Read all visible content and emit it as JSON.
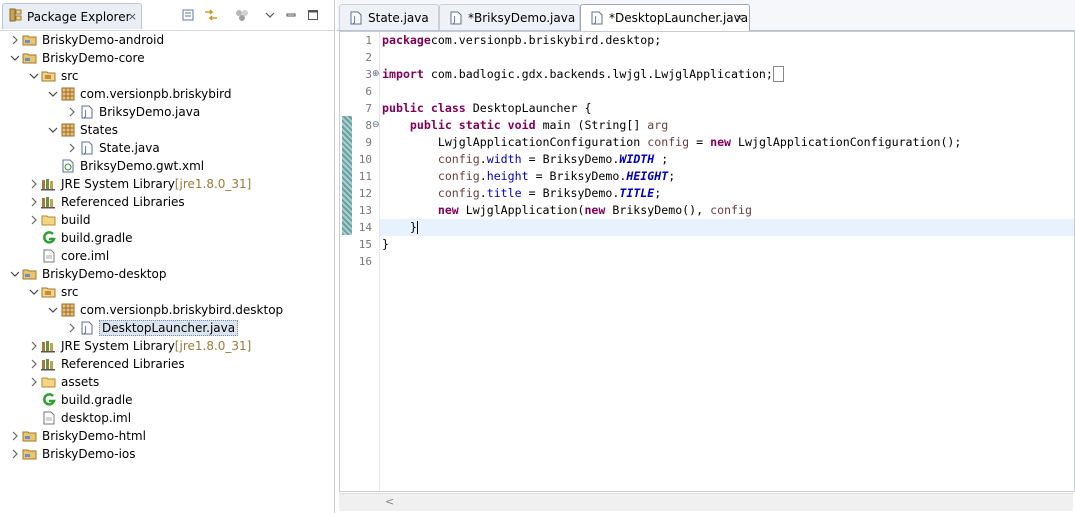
{
  "explorer": {
    "title": "Package Explorer",
    "close": "×",
    "toolbar": [
      "collapse-all-icon",
      "link-with-editor-icon",
      "focus-icon",
      "view-menu-icon",
      "minimize-icon",
      "maximize-icon"
    ],
    "tree": [
      {
        "depth": 0,
        "arrow": "right",
        "icon": "project-icon",
        "label": "BriskyDemo-android"
      },
      {
        "depth": 0,
        "arrow": "down",
        "icon": "project-icon",
        "label": "BriskyDemo-core"
      },
      {
        "depth": 1,
        "arrow": "down",
        "icon": "source-folder-icon",
        "label": "src"
      },
      {
        "depth": 2,
        "arrow": "down",
        "icon": "package-icon",
        "label": "com.versionpb.briskybird"
      },
      {
        "depth": 3,
        "arrow": "right",
        "icon": "java-file-icon",
        "label": "BriksyDemo.java"
      },
      {
        "depth": 2,
        "arrow": "down",
        "icon": "package-icon",
        "label": "States"
      },
      {
        "depth": 3,
        "arrow": "right",
        "icon": "java-file-icon",
        "label": "State.java"
      },
      {
        "depth": 2,
        "arrow": "",
        "icon": "gwt-xml-icon",
        "label": "BriksyDemo.gwt.xml"
      },
      {
        "depth": 1,
        "arrow": "right",
        "icon": "library-icon",
        "label": "JRE System Library",
        "suffix": "[jre1.8.0_31]"
      },
      {
        "depth": 1,
        "arrow": "right",
        "icon": "library-icon",
        "label": "Referenced Libraries"
      },
      {
        "depth": 1,
        "arrow": "right",
        "icon": "folder-icon",
        "label": "build"
      },
      {
        "depth": 1,
        "arrow": "",
        "icon": "gradle-icon",
        "label": "build.gradle"
      },
      {
        "depth": 1,
        "arrow": "",
        "icon": "file-icon",
        "label": "core.iml"
      },
      {
        "depth": 0,
        "arrow": "down",
        "icon": "project-icon",
        "label": "BriskyDemo-desktop"
      },
      {
        "depth": 1,
        "arrow": "down",
        "icon": "source-folder-icon",
        "label": "src"
      },
      {
        "depth": 2,
        "arrow": "down",
        "icon": "package-icon",
        "label": "com.versionpb.briskybird.desktop"
      },
      {
        "depth": 3,
        "arrow": "right",
        "icon": "java-file-icon",
        "label": "DesktopLauncher.java",
        "selected": true
      },
      {
        "depth": 1,
        "arrow": "right",
        "icon": "library-icon",
        "label": "JRE System Library",
        "suffix": "[jre1.8.0_31]"
      },
      {
        "depth": 1,
        "arrow": "right",
        "icon": "library-icon",
        "label": "Referenced Libraries"
      },
      {
        "depth": 1,
        "arrow": "right",
        "icon": "folder-icon",
        "label": "assets"
      },
      {
        "depth": 1,
        "arrow": "",
        "icon": "gradle-icon",
        "label": "build.gradle"
      },
      {
        "depth": 1,
        "arrow": "",
        "icon": "file-icon",
        "label": "desktop.iml"
      },
      {
        "depth": 0,
        "arrow": "right",
        "icon": "project-icon",
        "label": "BriskyDemo-html"
      },
      {
        "depth": 0,
        "arrow": "right",
        "icon": "project-icon",
        "label": "BriskyDemo-ios"
      }
    ]
  },
  "editor": {
    "tabs": [
      {
        "label": "State.java",
        "active": false
      },
      {
        "label": "*BriksyDemo.java",
        "active": false
      },
      {
        "label": "*DesktopLauncher.java",
        "active": true,
        "close": "×"
      }
    ],
    "hscroll_left": "<",
    "current_line": 14,
    "line_numbers": [
      "1",
      "2",
      "3",
      "6",
      "7",
      "8",
      "9",
      "10",
      "11",
      "12",
      "13",
      "14",
      "15",
      "16"
    ],
    "lines": [
      {
        "n": "1",
        "segs": [
          [
            "kw",
            "package"
          ],
          [
            "",
            "com.versionpb.briskybird.desktop;"
          ]
        ]
      },
      {
        "n": "2",
        "segs": []
      },
      {
        "n": "3",
        "fold": "⊕",
        "segs": [
          [
            "kw",
            "import"
          ],
          [
            "",
            " com.badlogic.gdx.backends.lwjgl.LwjglApplication;"
          ],
          [
            "box",
            "_"
          ]
        ]
      },
      {
        "n": "6",
        "segs": []
      },
      {
        "n": "7",
        "segs": [
          [
            "kw",
            "public"
          ],
          [
            "",
            " "
          ],
          [
            "kw",
            "class"
          ],
          [
            "",
            " DesktopLauncher {"
          ]
        ]
      },
      {
        "n": "8",
        "fold": "⊖",
        "segs": [
          [
            "",
            "    "
          ],
          [
            "kw",
            "public"
          ],
          [
            "",
            " "
          ],
          [
            "kw",
            "static"
          ],
          [
            "",
            " "
          ],
          [
            "kw",
            "void"
          ],
          [
            "",
            " main (String[] "
          ],
          [
            "var",
            "arg"
          ],
          [
            ") {"
          ]
        ]
      },
      {
        "n": "9",
        "segs": [
          [
            "",
            "        LwjglApplicationConfiguration "
          ],
          [
            "var",
            "config"
          ],
          [
            "",
            " = "
          ],
          [
            "kw",
            "new"
          ],
          [
            "",
            " LwjglApplicationConfiguration();"
          ]
        ]
      },
      {
        "n": "10",
        "segs": [
          [
            "",
            "        "
          ],
          [
            "var",
            "config"
          ],
          [
            "",
            "."
          ],
          [
            "fld",
            "width"
          ],
          [
            "",
            " = BriksyDemo."
          ],
          [
            "const",
            "WIDTH"
          ],
          [
            "",
            " ;"
          ]
        ]
      },
      {
        "n": "11",
        "segs": [
          [
            "",
            "        "
          ],
          [
            "var",
            "config"
          ],
          [
            "",
            "."
          ],
          [
            "fld",
            "height"
          ],
          [
            "",
            " = BriksyDemo."
          ],
          [
            "const",
            "HEIGHT"
          ],
          [
            "",
            ";"
          ]
        ]
      },
      {
        "n": "12",
        "segs": [
          [
            "",
            "        "
          ],
          [
            "var",
            "config"
          ],
          [
            "",
            "."
          ],
          [
            "fld",
            "title"
          ],
          [
            "",
            " = BriksyDemo."
          ],
          [
            "const",
            "TITLE"
          ],
          [
            "",
            ";"
          ]
        ]
      },
      {
        "n": "13",
        "segs": [
          [
            "",
            "        "
          ],
          [
            "kw",
            "new"
          ],
          [
            "",
            " LwjglApplication("
          ],
          [
            "kw",
            "new"
          ],
          [
            "",
            " BriksyDemo(), "
          ],
          [
            "var",
            "config"
          ],
          [
            ");"
          ]
        ]
      },
      {
        "n": "14",
        "segs": [
          [
            "",
            "    }"
          ],
          [
            "caret",
            ""
          ]
        ]
      },
      {
        "n": "15",
        "segs": [
          [
            "",
            "}"
          ]
        ]
      },
      {
        "n": "16",
        "segs": []
      }
    ]
  },
  "colors": {
    "keyword": "#7f0055",
    "field": "#0000c0",
    "variable": "#6a3e3e",
    "current_line": "#e8f2fe"
  }
}
